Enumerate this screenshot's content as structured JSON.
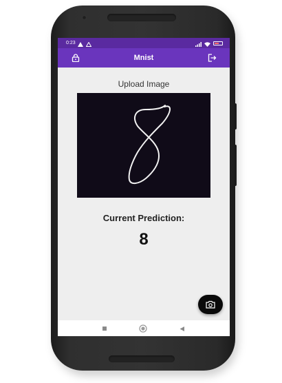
{
  "status_bar": {
    "time": "0:23",
    "battery_color": "#ff6b6b"
  },
  "app_bar": {
    "title": "Mnist",
    "left_icon": "lock-icon",
    "right_icon": "logout-icon",
    "color": "#6a35bd"
  },
  "main": {
    "upload_label": "Upload Image",
    "image_description_icon": "handwritten-digit-image",
    "prediction_label": "Current Prediction:",
    "prediction_value": "8"
  },
  "fab": {
    "icon": "camera-icon"
  },
  "nav_bar": {
    "icons": [
      "square-icon",
      "circle-icon",
      "back-triangle-icon"
    ]
  }
}
